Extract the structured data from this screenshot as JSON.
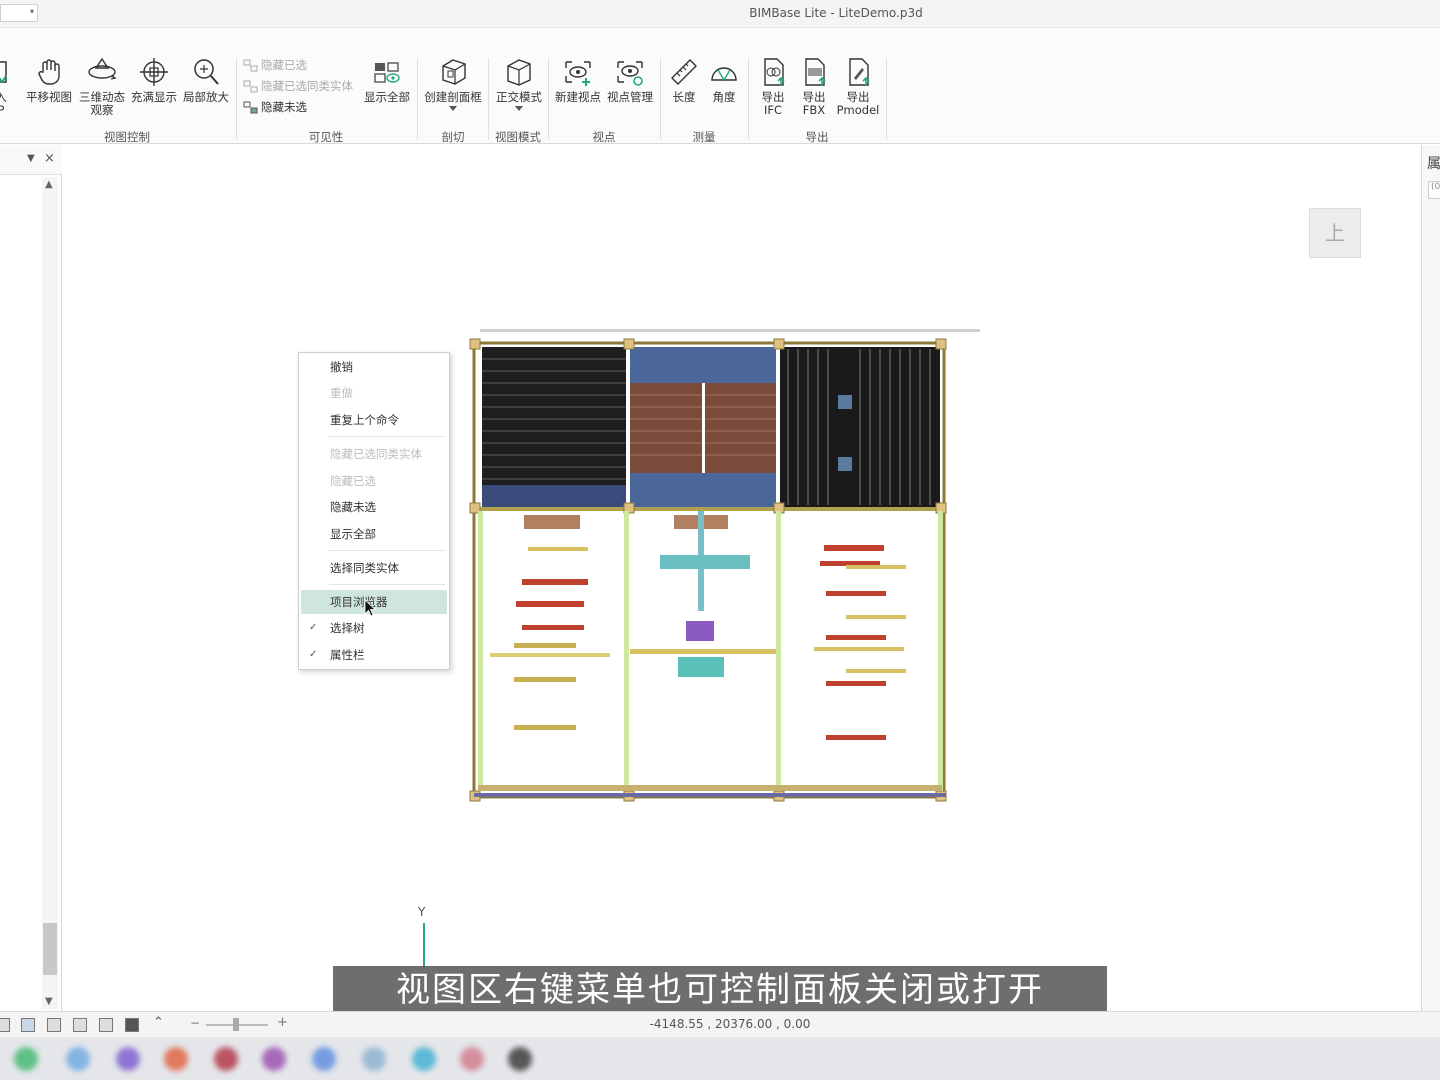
{
  "window": {
    "title": "BIMBase Lite - LiteDemo.p3d"
  },
  "ribbon": {
    "partial_left": {
      "line1": "入",
      "line2": "P"
    },
    "view_control": {
      "label": "视图控制",
      "pan": "平移视图",
      "orbit_l1": "三维动态",
      "orbit_l2": "观察",
      "fit": "充满显示",
      "zoom": "局部放大"
    },
    "visibility": {
      "label": "可见性",
      "hide_selected": "隐藏已选",
      "hide_same_type": "隐藏已选同类实体",
      "hide_unselected": "隐藏未选",
      "show_all": "显示全部"
    },
    "section": {
      "label": "剖切",
      "create_box": "创建剖面框"
    },
    "view_mode": {
      "label": "视图模式",
      "ortho": "正交模式"
    },
    "viewpoint": {
      "label": "视点",
      "new": "新建视点",
      "manage": "视点管理"
    },
    "measure": {
      "label": "测量",
      "length": "长度",
      "angle": "角度"
    },
    "export": {
      "label": "导出",
      "ifc_l1": "导出",
      "ifc_l2": "IFC",
      "fbx_l1": "导出",
      "fbx_l2": "FBX",
      "pmodel_l1": "导出",
      "pmodel_l2": "Pmodel"
    }
  },
  "viewport": {
    "viewcube_label": "上",
    "axis_y": "Y",
    "subtitle": "视图区右键菜单也可控制面板关闭或打开"
  },
  "right_panel": {
    "title_glyph": "属",
    "box_text": "(0"
  },
  "context_menu": {
    "items": [
      {
        "label": "撤销",
        "enabled": true
      },
      {
        "label": "重做",
        "enabled": false
      },
      {
        "label": "重复上个命令",
        "enabled": true
      },
      {
        "label": "隐藏已选同类实体",
        "enabled": false
      },
      {
        "label": "隐藏已选",
        "enabled": false
      },
      {
        "label": "隐藏未选",
        "enabled": true
      },
      {
        "label": "显示全部",
        "enabled": true
      },
      {
        "label": "选择同类实体",
        "enabled": true
      },
      {
        "label": "项目浏览器",
        "enabled": true,
        "highlighted": true,
        "checked": false
      },
      {
        "label": "选择树",
        "enabled": true,
        "checked": true
      },
      {
        "label": "属性栏",
        "enabled": true,
        "checked": true
      }
    ]
  },
  "status_bar": {
    "zoom_minus": "−",
    "zoom_plus": "+",
    "coordinates": "-4148.55 , 20376.00 , 0.00"
  },
  "colors": {
    "accent_highlight": "#cfe6df",
    "cursor_highlight": "#faf03c",
    "subtitle_bg": "#5a5a5a"
  }
}
